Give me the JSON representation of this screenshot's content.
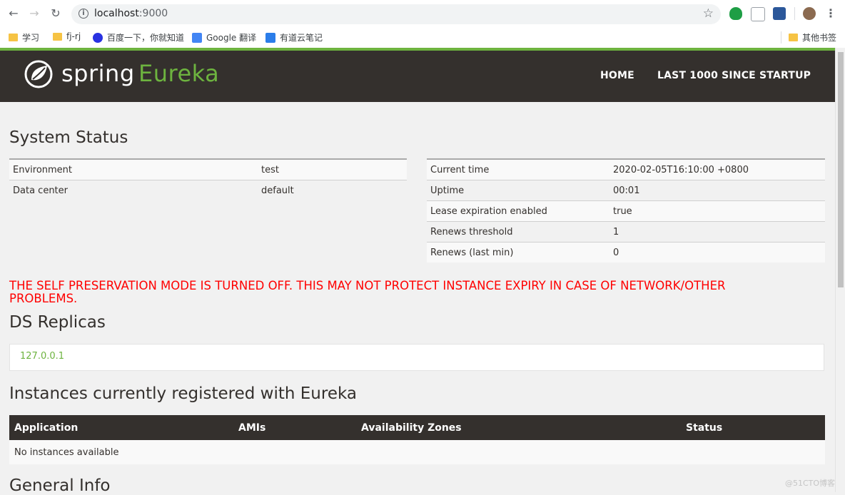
{
  "browser": {
    "url_host": "localhost",
    "url_port": ":9000",
    "bookmarks": [
      {
        "label": "学习"
      },
      {
        "label": "fj-rj"
      },
      {
        "label": "百度一下，你就知道"
      },
      {
        "label": "Google 翻译"
      },
      {
        "label": "有道云笔记"
      }
    ],
    "other_bookmarks": "其他书签"
  },
  "header": {
    "logo_spring": "spring",
    "logo_eureka": "Eureka",
    "nav": [
      "HOME",
      "LAST 1000 SINCE STARTUP"
    ]
  },
  "system_status": {
    "title": "System Status",
    "left": [
      {
        "label": "Environment",
        "value": "test"
      },
      {
        "label": "Data center",
        "value": "default"
      }
    ],
    "right": [
      {
        "label": "Current time",
        "value": "2020-02-05T16:10:00 +0800"
      },
      {
        "label": "Uptime",
        "value": "00:01"
      },
      {
        "label": "Lease expiration enabled",
        "value": "true"
      },
      {
        "label": "Renews threshold",
        "value": "1"
      },
      {
        "label": "Renews (last min)",
        "value": "0"
      }
    ]
  },
  "warning": "THE SELF PRESERVATION MODE IS TURNED OFF. THIS MAY NOT PROTECT INSTANCE EXPIRY IN CASE OF NETWORK/OTHER PROBLEMS.",
  "replicas": {
    "title": "DS Replicas",
    "items": [
      "127.0.0.1"
    ]
  },
  "instances": {
    "title": "Instances currently registered with Eureka",
    "columns": [
      "Application",
      "AMIs",
      "Availability Zones",
      "Status"
    ],
    "empty_text": "No instances available"
  },
  "general_info": {
    "title": "General Info"
  },
  "watermark": "@51CTO博客",
  "colors": {
    "brand_green": "#6db33f",
    "header_bg": "#34302d",
    "warning_red": "#ff0000"
  }
}
